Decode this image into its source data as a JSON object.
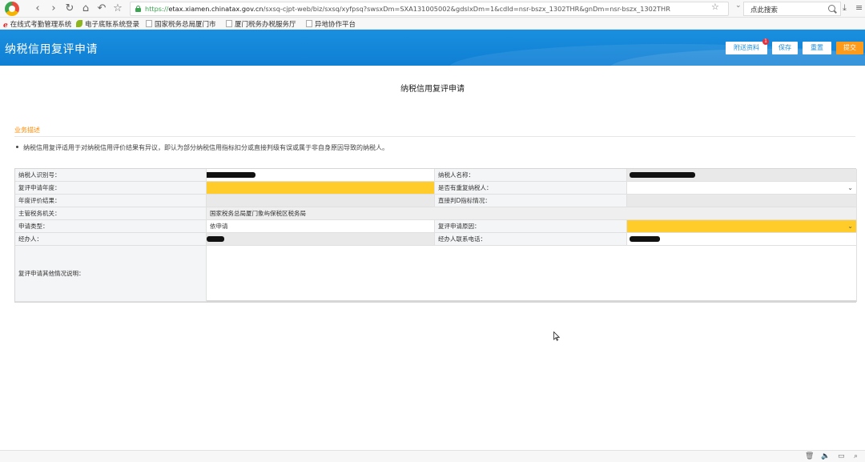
{
  "browser": {
    "url_scheme": "https://",
    "url_host": "etax.xiamen.chinatax.gov.cn",
    "url_path": "/sxsq-cjpt-web/biz/sxsq/xyfpsq?swsxDm=SXA131005002&gdslxDm=1&cdId=nsr-bszx_1302THR&gnDm=nsr-bszx_1302THR",
    "search_placeholder": "点此搜索",
    "nav_icons": [
      "back-icon",
      "forward-icon",
      "refresh-icon",
      "home-icon",
      "undo-icon",
      "star-icon"
    ],
    "bookmarks": [
      {
        "label": "在线式考勤管理系统",
        "icon": "red-logo-icon"
      },
      {
        "label": "电子底账系统登录",
        "icon": "leaf-icon"
      },
      {
        "label": "国家税务总局厦门市",
        "icon": "page-icon"
      },
      {
        "label": "厦门税务办税服务厅",
        "icon": "page-icon"
      },
      {
        "label": "异地协作平台",
        "icon": "page-icon"
      }
    ]
  },
  "header": {
    "title": "纳税信用复评申请",
    "buttons": {
      "attach": "附送资料",
      "save": "保存",
      "reset": "重置",
      "submit": "提交"
    },
    "attach_badge": "1",
    "colors": {
      "bar": "#1a8fdf",
      "submit": "#ff9b1a",
      "highlight": "#ffcc2a",
      "section": "#ff8a00"
    }
  },
  "main": {
    "page_title": "纳税信用复评申请",
    "section_title": "业务描述",
    "description": "纳税信用复评适用于对纳税信用评价结果有异议，即认为部分纳税信用指标扣分或直接判级有误或属于非自身原因导致的纳税人。"
  },
  "form": {
    "taxpayer_id_label": "纳税人识别号：",
    "taxpayer_name_label": "纳税人名称：",
    "review_year_label": "复评申请年度：",
    "has_major_taxpayer_label": "是否有重复纳税人：",
    "annual_result_label": "年度评价结果：",
    "direct_d_label": "直接判D指标情况：",
    "tax_authority_label": "主管税务机关：",
    "tax_authority_value": "国家税务总局厦门象屿保税区税务局",
    "apply_type_label": "申请类型：",
    "apply_type_value": "依申请",
    "review_reason_label": "复评申请原因：",
    "agent_label": "经办人：",
    "agent_phone_label": "经办人联系电话：",
    "other_info_label": "复评申请其他情况说明："
  },
  "statusbar_icons": [
    "trash-icon",
    "speaker-icon",
    "window-icon",
    "zoom-icon"
  ]
}
